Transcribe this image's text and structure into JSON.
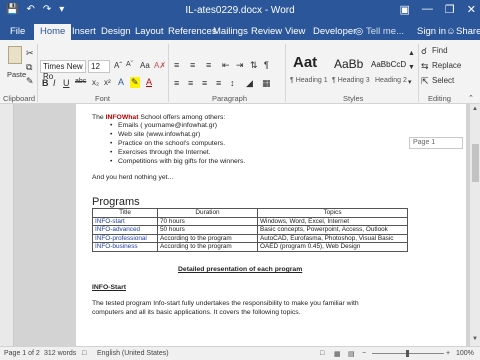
{
  "window": {
    "title": "IL-ates0229.docx - Word",
    "quick_access": [
      "save-icon",
      "undo-icon",
      "redo-icon",
      "customize-icon"
    ],
    "controls": [
      "minimize",
      "restore",
      "close"
    ]
  },
  "tabs": [
    "File",
    "Home",
    "Insert",
    "Design",
    "Layout",
    "References",
    "Mailings",
    "Review",
    "View",
    "Developer"
  ],
  "active_tab": "Home",
  "tell_me": "Tell me...",
  "sign_in": "Sign in",
  "share": "Share",
  "ribbon": {
    "clipboard": {
      "paste": "Paste",
      "label": "Clipboard"
    },
    "font": {
      "name": "Times New Ro",
      "size": "12",
      "label": "Font",
      "buttons": [
        "B",
        "I",
        "U",
        "abc",
        "x₂",
        "x²"
      ]
    },
    "paragraph": {
      "label": "Paragraph"
    },
    "styles": {
      "label": "Styles",
      "items": [
        {
          "preview": "Aat",
          "name": "¶ Heading 1"
        },
        {
          "preview": "AaBb",
          "name": "¶ Heading 3"
        },
        {
          "preview": "AaBbCcD",
          "name": "Heading 2"
        }
      ]
    },
    "editing": {
      "label": "Editing",
      "find": "Find",
      "replace": "Replace",
      "select": "Select"
    }
  },
  "document": {
    "intro_prefix": "The ",
    "intro_brand": "INFOWhat",
    "intro_suffix": " School offers among others:",
    "bullets": [
      "Emails ( yourname@infowhat.gr)",
      "Web site (www.infowhat.gr)",
      "Practice on the school's computers.",
      "Exercises through the Internet.",
      "Competitions with big gifts for the winners."
    ],
    "line2": "And you herd nothing yet...",
    "programs_heading": "Programs",
    "table": {
      "headers": [
        "Title",
        "Duration",
        "Topics"
      ],
      "rows": [
        [
          "INFO-start",
          "70 hours",
          "Windows, Word, Excel, Internet"
        ],
        [
          "INFO-advanced",
          "50 hours",
          "Basic concepts, Powerpoint, Access, Outlook"
        ],
        [
          "INFO-professional",
          "According to the program",
          "AutoCAD, Eurofasma, Photoshop, Visual Basic"
        ],
        [
          "INFO-business",
          "According to the program",
          "OAED (program 0.45), Web Design"
        ]
      ]
    },
    "detailed_heading": "Detailed presentation of each program",
    "info_start_heading": "INFO-Start",
    "para1": "The tested program Info-start fully undertakes the responsibility to make you familiar with",
    "para2": "computers and all its basic applications. It covers the following topics."
  },
  "page_badge": "Page 1",
  "status": {
    "page": "Page 1 of 2",
    "words": "312 words",
    "language": "English (United States)",
    "zoom": "100%"
  }
}
